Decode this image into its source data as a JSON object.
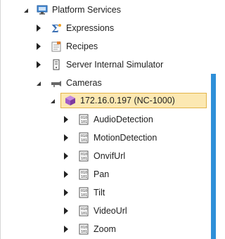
{
  "tree": {
    "root": {
      "label": "Platform Services",
      "icon": "monitor-services-icon",
      "expanded": true
    },
    "children": [
      {
        "label": "Expressions",
        "icon": "sigma-icon",
        "expanded": false
      },
      {
        "label": "Recipes",
        "icon": "recipe-book-icon",
        "expanded": false
      },
      {
        "label": "Server Internal Simulator",
        "icon": "server-icon",
        "expanded": false
      },
      {
        "label": "Cameras",
        "icon": "camera-icon",
        "expanded": true
      }
    ],
    "camera": {
      "label": "172.16.0.197 (NC-1000)",
      "icon": "cube-device-icon",
      "expanded": true,
      "selected": true
    },
    "camera_items": [
      {
        "label": "AudioDetection",
        "icon": "property-icon"
      },
      {
        "label": "MotionDetection",
        "icon": "property-icon"
      },
      {
        "label": "OnvifUrl",
        "icon": "property-icon"
      },
      {
        "label": "Pan",
        "icon": "property-icon"
      },
      {
        "label": "Tilt",
        "icon": "property-icon"
      },
      {
        "label": "VideoUrl",
        "icon": "property-icon"
      },
      {
        "label": "Zoom",
        "icon": "property-icon"
      }
    ]
  },
  "colors": {
    "selection_bg": "#fce8b2",
    "selection_border": "#e2b44a",
    "accent_bar": "#2e8fd8",
    "device_purple": "#a15bc7"
  }
}
